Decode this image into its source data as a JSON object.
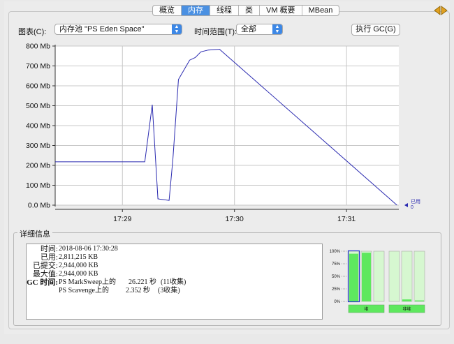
{
  "tabs": [
    {
      "label": "概览",
      "active": false
    },
    {
      "label": "内存",
      "active": true
    },
    {
      "label": "线程",
      "active": false
    },
    {
      "label": "类",
      "active": false
    },
    {
      "label": "VM 概要",
      "active": false
    },
    {
      "label": "MBean",
      "active": false
    }
  ],
  "controls": {
    "chart_label": "图表(C):",
    "chart_select": "内存池 \"PS Eden Space\"",
    "range_label": "时间范围(T):",
    "range_select": "全部",
    "gc_button": "执行 GC(G)"
  },
  "chart_data": {
    "type": "line",
    "title": "",
    "xlabel": "",
    "ylabel": "",
    "y_unit": "Mb",
    "ylim": [
      0,
      800
    ],
    "yticks": [
      "0.0 Mb",
      "100 Mb",
      "200 Mb",
      "300 Mb",
      "400 Mb",
      "500 Mb",
      "600 Mb",
      "700 Mb",
      "800 Mb"
    ],
    "xticks": [
      "17:29",
      "17:30",
      "17:31"
    ],
    "grid": true,
    "line_color": "#2a2ab0",
    "series": [
      {
        "name": "已用",
        "current_value": "0",
        "points": [
          [
            "17:28:24",
            218
          ],
          [
            "17:29:12",
            218
          ],
          [
            "17:29:16",
            505
          ],
          [
            "17:29:19",
            32
          ],
          [
            "17:29:20",
            30
          ],
          [
            "17:29:25",
            24
          ],
          [
            "17:29:27",
            230
          ],
          [
            "17:29:30",
            632
          ],
          [
            "17:29:36",
            729
          ],
          [
            "17:29:39",
            742
          ],
          [
            "17:29:42",
            771
          ],
          [
            "17:29:46",
            780
          ],
          [
            "17:29:52",
            784
          ],
          [
            "17:31:27",
            0
          ]
        ]
      }
    ]
  },
  "details": {
    "title": "详细信息",
    "rows": [
      {
        "key": "时间:",
        "value": "2018-08-06 17:30:28"
      },
      {
        "key": "已用:",
        "value": "2,811,215 KB"
      },
      {
        "key": "已提交:",
        "value": "2,944,000 KB"
      },
      {
        "key": "最大值:",
        "value": "2,944,000 KB"
      }
    ],
    "gc_key": "GC 时间:",
    "gc": [
      {
        "name": "PS MarkSweep上的",
        "time": "26.221 秒",
        "count": "(11收集)"
      },
      {
        "name": "PS Scavenge上的",
        "time": "2.352 秒",
        "count": "(3收集)"
      }
    ]
  },
  "gauges": {
    "axis_labels": [
      "100%",
      "75%",
      "50%",
      "25%",
      "0%"
    ],
    "heap_label": "堆",
    "nonheap_label": "非堆",
    "heap_levels": [
      {
        "used": 0.95,
        "committed": 1.0
      },
      {
        "used": 0.97,
        "committed": 1.0
      },
      {
        "used": 0.0,
        "committed": 1.0
      }
    ],
    "nonheap_levels": [
      {
        "used": 0.0,
        "committed": 1.0
      },
      {
        "used": 0.04,
        "committed": 1.0
      },
      {
        "used": 0.02,
        "committed": 1.0
      }
    ],
    "colors": {
      "used": "#5ee85e",
      "committed": "#d6f7d0",
      "label_bg": "#5ee85e",
      "selected": "#2233cc"
    }
  }
}
